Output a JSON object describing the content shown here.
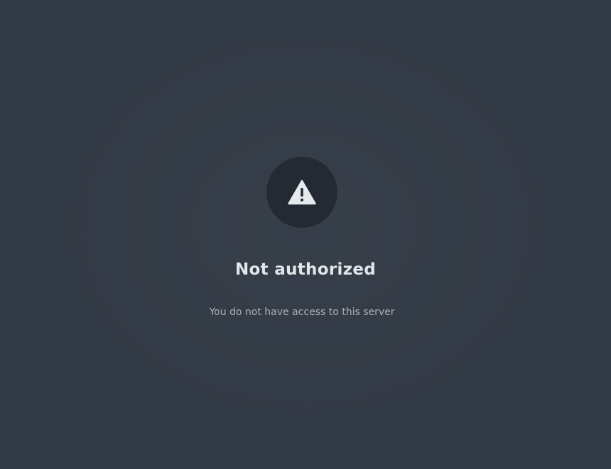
{
  "error": {
    "icon": "warning-icon",
    "title": "Not authorized",
    "message": "You do not have access to this server"
  },
  "colors": {
    "background": "#323a45",
    "icon_circle": "#232a34",
    "icon": "#e6e9ed",
    "title": "#e3e6ea",
    "message": "#aab1bb"
  }
}
